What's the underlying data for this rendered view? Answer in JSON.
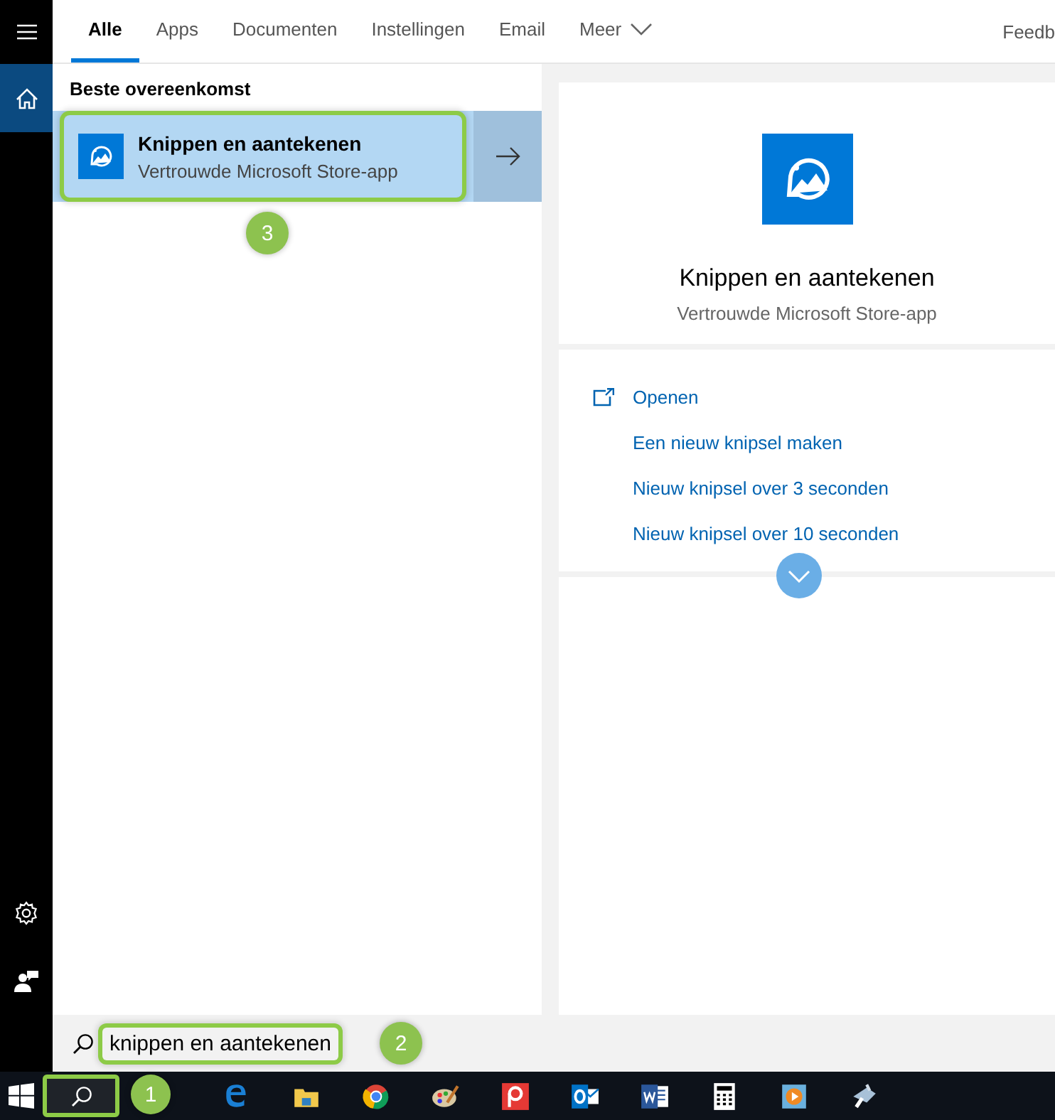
{
  "tabs": [
    {
      "label": "Alle",
      "selected": true,
      "kind": "tab"
    },
    {
      "label": "Apps",
      "selected": false,
      "kind": "tab"
    },
    {
      "label": "Documenten",
      "selected": false,
      "kind": "tab"
    },
    {
      "label": "Instellingen",
      "selected": false,
      "kind": "tab"
    },
    {
      "label": "Email",
      "selected": false,
      "kind": "tab"
    },
    {
      "label": "Meer",
      "selected": false,
      "kind": "menu"
    }
  ],
  "feedback_link": "Feedb",
  "best_match": {
    "heading": "Beste overeenkomst",
    "title": "Knippen en aantekenen",
    "subtitle": "Vertrouwde Microsoft Store-app",
    "selected": true,
    "highlighted": true,
    "badge": "3"
  },
  "details": {
    "title": "Knippen en aantekenen",
    "subtitle": "Vertrouwde Microsoft Store-app",
    "actions": [
      {
        "label": "Openen",
        "kind": "open"
      },
      {
        "label": "Een nieuw knipsel maken",
        "kind": "plain"
      },
      {
        "label": "Nieuw knipsel over 3 seconden",
        "kind": "plain"
      },
      {
        "label": "Nieuw knipsel over 10 seconden",
        "kind": "plain"
      }
    ]
  },
  "search": {
    "value": "knippen en aantekenen",
    "highlighted": true,
    "badge": "2"
  },
  "taskbar": {
    "search_highlighted": true,
    "badge": "1"
  }
}
